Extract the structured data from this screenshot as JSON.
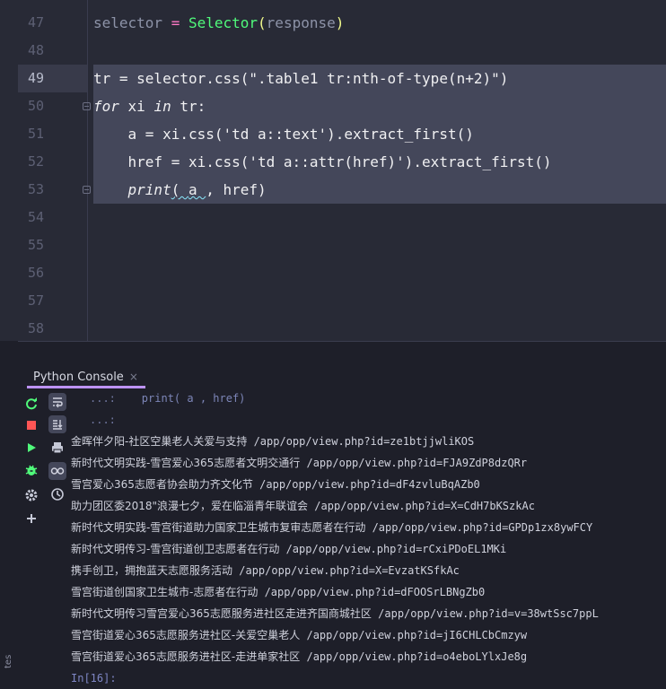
{
  "editor": {
    "lines": [
      {
        "num": "47",
        "t1": "selector",
        "t2": " = ",
        "t3": "Selector",
        "t4": "(",
        "t5": "response",
        "t6": ")"
      },
      {
        "num": "48"
      },
      {
        "num": "49",
        "code": "tr = selector.css(\".table1 tr:nth-of-type(n+2)\")"
      },
      {
        "num": "50",
        "kw": "for",
        "mid": " xi ",
        "kw2": "in",
        "rest": " tr:"
      },
      {
        "num": "51",
        "code": "    a = xi.css('td a::text').extract_first()"
      },
      {
        "num": "52",
        "code": "    href = xi.css('td a::attr(href)').extract_first()"
      },
      {
        "num": "53",
        "indent": "    ",
        "fn": "print",
        "p1": "( ",
        "a": "a ",
        "sep": ", href)"
      },
      {
        "num": "54"
      },
      {
        "num": "55"
      },
      {
        "num": "56"
      },
      {
        "num": "57"
      },
      {
        "num": "58"
      }
    ]
  },
  "console": {
    "tab_label": "Python Console",
    "tab_close": "×",
    "output": [
      {
        "prompt": "...:",
        "code": "    print( a , href)"
      },
      {
        "prompt": "...:",
        "code": ""
      },
      {
        "cn": "金晖伴夕阳-社区空巢老人关爱与支持",
        "url": "/app/opp/view.php?id=ze1btjjwliKOS"
      },
      {
        "cn": "新时代文明实践-雪宫爱心365志愿者文明交通行",
        "url": "/app/opp/view.php?id=FJA9ZdP8dzQRr"
      },
      {
        "cn": "雪宫爱心365志愿者协会助力齐文化节",
        "url": "/app/opp/view.php?id=dF4zvluBqAZb0"
      },
      {
        "cn": "助力团区委2018\"浪漫七夕，爱在临淄青年联谊会",
        "url": "/app/opp/view.php?id=X=CdH7bKSzkAc"
      },
      {
        "cn": "新时代文明实践-雪宫街道助力国家卫生城市复审志愿者在行动",
        "url": "/app/opp/view.php?id=GPDp1zx8ywFCY"
      },
      {
        "cn": "新时代文明传习-雪宫街道创卫志愿者在行动",
        "url": "/app/opp/view.php?id=rCxiPDoEL1MKi"
      },
      {
        "cn": "携手创卫，拥抱蓝天志愿服务活动",
        "url": "/app/opp/view.php?id=X=EvzatKSfkAc"
      },
      {
        "cn": "雪宫街道创国家卫生城市-志愿者在行动",
        "url": "/app/opp/view.php?id=dFOOSrLBNgZb0"
      },
      {
        "cn": "新时代文明传习雪宫爱心365志愿服务进社区走进齐国商城社区",
        "url": "/app/opp/view.php?id=v=38wtSsc7ppL"
      },
      {
        "cn": "雪宫街道爱心365志愿服务进社区-关爱空巢老人",
        "url": "/app/opp/view.php?id=jI6CHLCbCmzyw"
      },
      {
        "cn": "雪宫街道爱心365志愿服务进社区-走进单家社区",
        "url": "/app/opp/view.php?id=o4eboLYlxJe8g"
      }
    ],
    "input_prompt": "In[16]:"
  },
  "side_panel": {
    "label": "tes"
  },
  "colors": {
    "accent": "#bd93f9",
    "selection": "#44475a",
    "function": "#50fa7b"
  }
}
